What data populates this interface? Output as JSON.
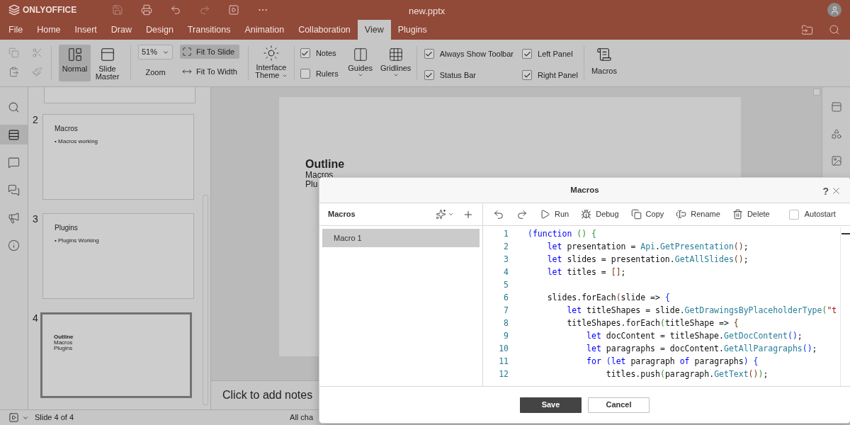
{
  "header": {
    "logo": "ONLYOFFICE",
    "file_name": "new.pptx"
  },
  "menu_tabs": [
    {
      "label": "File",
      "selected": false
    },
    {
      "label": "Home",
      "selected": false
    },
    {
      "label": "Insert",
      "selected": false
    },
    {
      "label": "Draw",
      "selected": false
    },
    {
      "label": "Design",
      "selected": false
    },
    {
      "label": "Transitions",
      "selected": false
    },
    {
      "label": "Animation",
      "selected": false
    },
    {
      "label": "Collaboration",
      "selected": false
    },
    {
      "label": "View",
      "selected": true
    },
    {
      "label": "Plugins",
      "selected": false
    }
  ],
  "toolbar": {
    "views": [
      {
        "label": "Normal",
        "kind": "normal",
        "selected": true
      },
      {
        "label": "Slide Master",
        "kind": "master",
        "selected": false
      }
    ],
    "zoom": {
      "value": "51%",
      "label": "Zoom"
    },
    "fit": [
      {
        "label": "Fit To Slide",
        "kind": "slide",
        "selected": true
      },
      {
        "label": "Fit To Width",
        "kind": "width",
        "selected": false
      }
    ],
    "interface_theme": "Interface Theme",
    "show": [
      {
        "label": "Notes",
        "checked": true
      },
      {
        "label": "Rulers",
        "checked": false
      }
    ],
    "grids": [
      {
        "label": "Guides",
        "kind": "guides"
      },
      {
        "label": "Gridlines",
        "kind": "gridlines"
      }
    ],
    "panels": [
      {
        "label": "Always Show Toolbar",
        "checked": true
      },
      {
        "label": "Status Bar",
        "checked": true
      },
      {
        "label": "Left Panel",
        "checked": true
      },
      {
        "label": "Right Panel",
        "checked": true
      }
    ],
    "macros": "Macros"
  },
  "left_nav": [
    {
      "kind": "search",
      "selected": false
    },
    {
      "kind": "slides",
      "selected": true
    },
    {
      "kind": "comments",
      "selected": false
    },
    {
      "kind": "chat",
      "selected": false
    },
    {
      "kind": "announce",
      "selected": false
    },
    {
      "kind": "info",
      "selected": false
    }
  ],
  "thumbnails": [
    {
      "number": "2",
      "title": "Macros",
      "bullet": "• Macros working",
      "selected": false
    },
    {
      "number": "3",
      "title": "Plugins",
      "bullet": "• Plugins Working",
      "selected": false
    },
    {
      "number": "4",
      "lines": [
        "Outline",
        "Macros",
        "Plugins"
      ],
      "selected": true
    }
  ],
  "slide": {
    "title": "Outline",
    "lines": [
      "Macros",
      "Plu"
    ]
  },
  "notes_placeholder": "Click to add notes",
  "status_bar": {
    "slide_counter": "Slide 4 of 4",
    "save_status": "All cha"
  },
  "right_panel": [
    {
      "kind": "slide"
    },
    {
      "kind": "shape"
    },
    {
      "kind": "image"
    }
  ],
  "dialog": {
    "title": "Macros",
    "help": "?",
    "list_title": "Macros",
    "macros": [
      {
        "name": "Macro 1",
        "selected": true
      }
    ],
    "actions": [
      {
        "label": "Run",
        "kind": "run"
      },
      {
        "label": "Debug",
        "kind": "debug"
      },
      {
        "label": "Copy",
        "kind": "copy"
      },
      {
        "label": "Rename",
        "kind": "rename"
      },
      {
        "label": "Delete",
        "kind": "delete"
      }
    ],
    "autostart": {
      "label": "Autostart",
      "checked": false
    },
    "code": [
      {
        "number": "1",
        "tokens": [
          {
            "t": "(",
            "kind": "b1"
          },
          {
            "t": "function",
            "kind": "kw"
          },
          {
            "t": " ()",
            "kind": "b2"
          },
          {
            "t": " {",
            "kind": "b2"
          }
        ]
      },
      {
        "number": "2",
        "tokens": [
          {
            "t": "    let",
            "kind": "kw"
          },
          {
            "t": " presentation = "
          },
          {
            "t": "Api",
            "kind": "fn"
          },
          {
            "t": "."
          },
          {
            "t": "GetPresentation",
            "kind": "fn"
          },
          {
            "t": "()",
            "kind": "b3"
          },
          {
            "t": ";"
          }
        ]
      },
      {
        "number": "3",
        "tokens": [
          {
            "t": "    let",
            "kind": "kw"
          },
          {
            "t": " slides = presentation."
          },
          {
            "t": "GetAllSlides",
            "kind": "fn"
          },
          {
            "t": "()",
            "kind": "b3"
          },
          {
            "t": ";"
          }
        ]
      },
      {
        "number": "4",
        "tokens": [
          {
            "t": "    let",
            "kind": "kw"
          },
          {
            "t": " titles = "
          },
          {
            "t": "[]",
            "kind": "b3"
          },
          {
            "t": ";"
          }
        ]
      },
      {
        "number": "5"
      },
      {
        "number": "6",
        "tokens": [
          {
            "t": "    slides.forEach"
          },
          {
            "t": "(",
            "kind": "b3"
          },
          {
            "t": "slide => "
          },
          {
            "t": "{",
            "kind": "b1"
          }
        ]
      },
      {
        "number": "7",
        "tokens": [
          {
            "t": "        let",
            "kind": "kw"
          },
          {
            "t": " titleShapes = slide."
          },
          {
            "t": "GetDrawingsByPlaceholderType",
            "kind": "fn"
          },
          {
            "t": "(",
            "kind": "b2"
          },
          {
            "t": "\"t",
            "kind": "str"
          }
        ]
      },
      {
        "number": "8",
        "tokens": [
          {
            "t": "        titleShapes.forEach"
          },
          {
            "t": "(",
            "kind": "b2"
          },
          {
            "t": "titleShape => "
          },
          {
            "t": "{",
            "kind": "b3"
          }
        ]
      },
      {
        "number": "9",
        "tokens": [
          {
            "t": "            let",
            "kind": "kw"
          },
          {
            "t": " docContent = titleShape."
          },
          {
            "t": "GetDocContent",
            "kind": "fn"
          },
          {
            "t": "()",
            "kind": "b1"
          },
          {
            "t": ";"
          }
        ]
      },
      {
        "number": "10",
        "tokens": [
          {
            "t": "            let",
            "kind": "kw"
          },
          {
            "t": " paragraphs = docContent."
          },
          {
            "t": "GetAllParagraphs",
            "kind": "fn"
          },
          {
            "t": "()",
            "kind": "b1"
          },
          {
            "t": ";"
          }
        ]
      },
      {
        "number": "11",
        "tokens": [
          {
            "t": "            for",
            "kind": "kw"
          },
          {
            "t": " (",
            "kind": "b1"
          },
          {
            "t": "let",
            "kind": "kw"
          },
          {
            "t": " paragraph "
          },
          {
            "t": "of",
            "kind": "kw"
          },
          {
            "t": " paragraphs"
          },
          {
            "t": ")",
            "kind": "b1"
          },
          {
            "t": " {",
            "kind": "b1"
          }
        ]
      },
      {
        "number": "12",
        "tokens": [
          {
            "t": "                titles.push"
          },
          {
            "t": "(",
            "kind": "b2"
          },
          {
            "t": "paragraph."
          },
          {
            "t": "GetText",
            "kind": "fn"
          },
          {
            "t": "()",
            "kind": "b3"
          },
          {
            "t": ")",
            "kind": "b2"
          },
          {
            "t": ";"
          }
        ]
      }
    ],
    "buttons": [
      {
        "label": "Save",
        "kind": "primary"
      },
      {
        "label": "Cancel",
        "kind": "secondary"
      }
    ]
  }
}
